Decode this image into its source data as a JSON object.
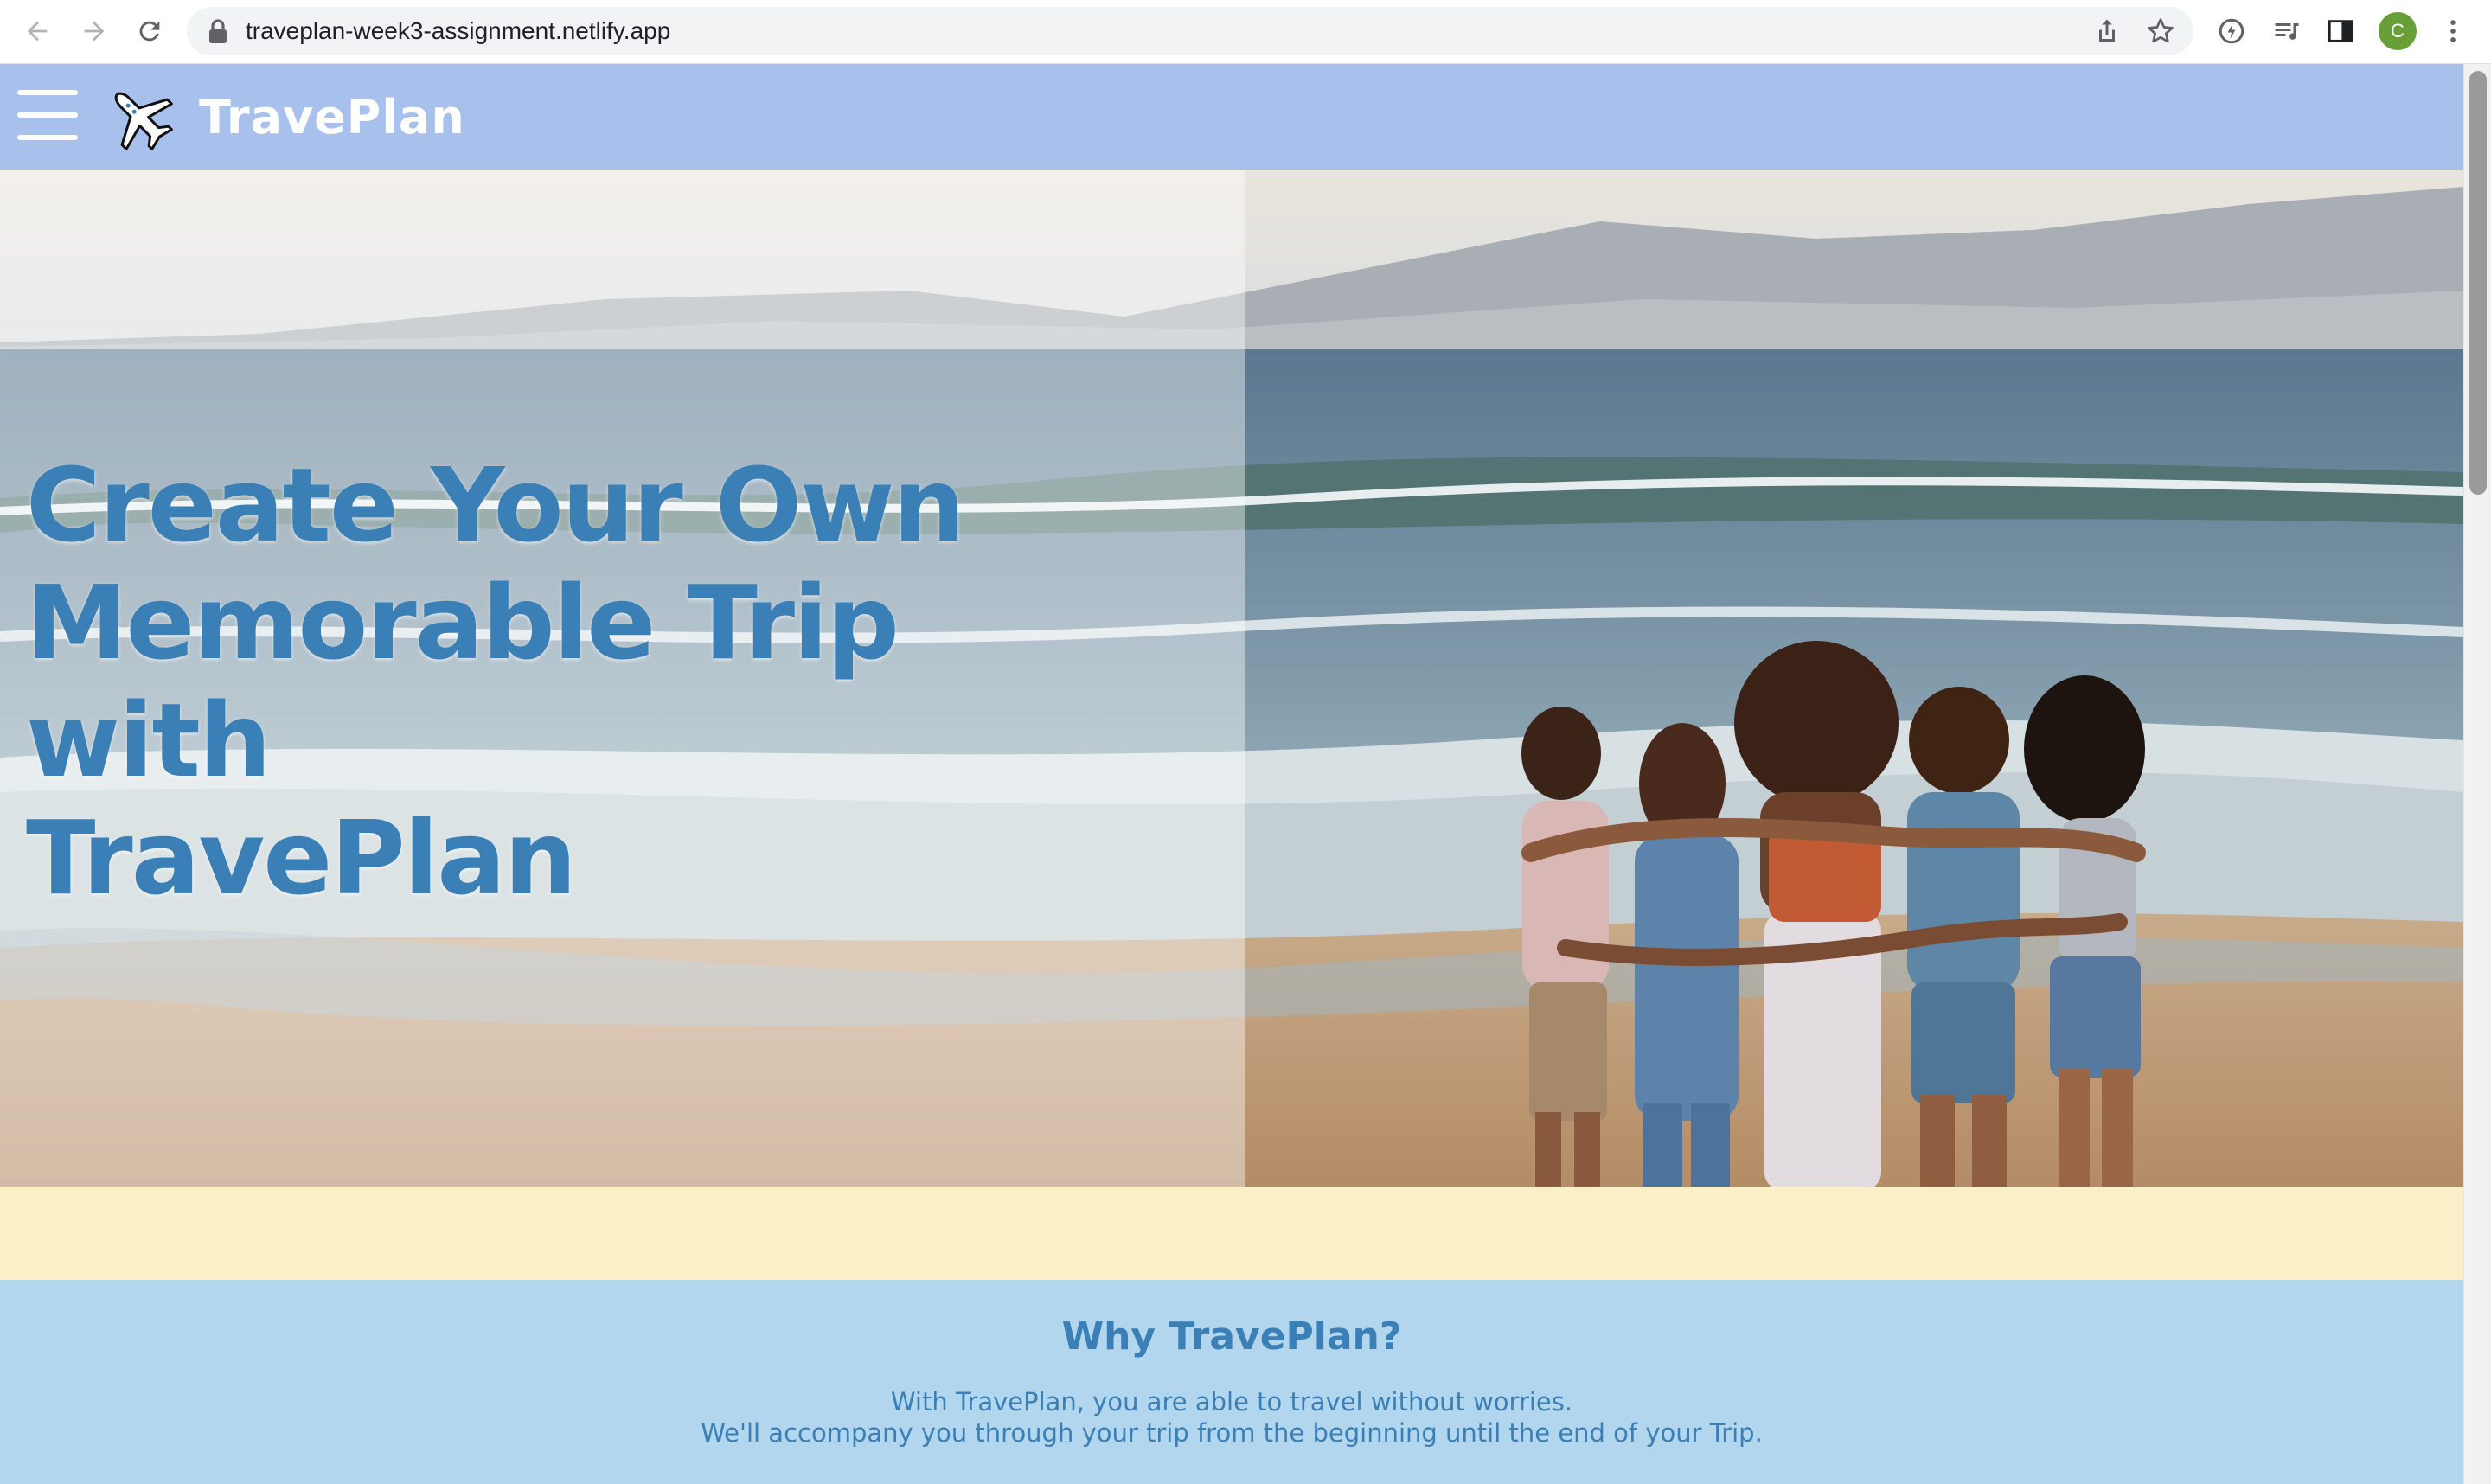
{
  "browser": {
    "url": "traveplan-week3-assignment.netlify.app",
    "profile_initial": "C",
    "profile_color": "#689f38"
  },
  "site": {
    "brand": "TravePlan",
    "header_color": "#a8c1ec",
    "accent_color": "#3a7fb5"
  },
  "hero": {
    "title_line1": "Create Your Own",
    "title_line2": "Memorable Trip with",
    "title_line3": "TravePlan"
  },
  "band": {
    "color": "#faefc6"
  },
  "why": {
    "title": "Why TravePlan?",
    "line1": "With TravePlan, you are able to travel without worries.",
    "line2": "We'll accompany you through your trip from the beginning until the end of your Trip.",
    "bg_color": "#b1d6ee"
  },
  "icons": [
    "back-icon",
    "forward-icon",
    "reload-icon",
    "lock-icon",
    "share-icon",
    "star-icon",
    "extension-icon",
    "media-icon",
    "sidepanel-icon",
    "menu-dots-icon",
    "hamburger-icon",
    "airplane-icon"
  ]
}
